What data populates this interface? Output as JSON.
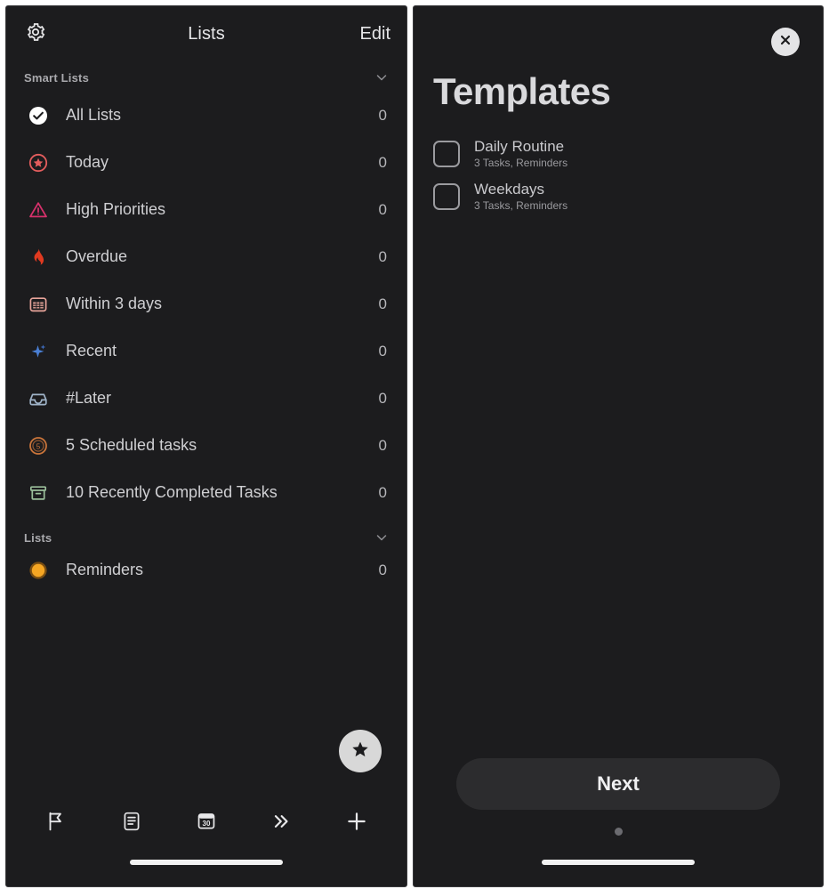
{
  "left_panel": {
    "header": {
      "settings_icon": "gear-icon",
      "title": "Lists",
      "edit_label": "Edit"
    },
    "sections": [
      {
        "label": "Smart Lists",
        "collapse_icon": "chevron-down-icon",
        "items": [
          {
            "icon": "check-circle-icon",
            "label": "All Lists",
            "count": "0",
            "color": "#ffffff"
          },
          {
            "icon": "star-circle-icon",
            "label": "Today",
            "count": "0",
            "color": "#e35d5d"
          },
          {
            "icon": "warning-triangle-icon",
            "label": "High Priorities",
            "count": "0",
            "color": "#d6306b"
          },
          {
            "icon": "flame-icon",
            "label": "Overdue",
            "count": "0",
            "color": "#e03a20"
          },
          {
            "icon": "calendar-icon",
            "label": "Within 3 days",
            "count": "0",
            "color": "#e8a49a"
          },
          {
            "icon": "sparkle-icon",
            "label": "Recent",
            "count": "0",
            "color": "#4a7fd4"
          },
          {
            "icon": "inbox-icon",
            "label": "#Later",
            "count": "0",
            "color": "#9fb3c8"
          },
          {
            "icon": "clock-five-icon",
            "label": "5 Scheduled tasks",
            "count": "0",
            "color": "#c9743a"
          },
          {
            "icon": "archive-box-icon",
            "label": "10 Recently Completed Tasks",
            "count": "0",
            "color": "#9bbf9b"
          }
        ]
      },
      {
        "label": "Lists",
        "collapse_icon": "chevron-down-icon",
        "items": [
          {
            "icon": "filled-circle-icon",
            "label": "Reminders",
            "count": "0",
            "color": "#f5a623"
          }
        ]
      }
    ],
    "fab": {
      "icon": "star-icon"
    },
    "tabbar": [
      {
        "icon": "flag-icon",
        "name": "tab-flag"
      },
      {
        "icon": "list-note-icon",
        "name": "tab-notes"
      },
      {
        "icon": "calendar-30-icon",
        "name": "tab-calendar",
        "badge": "30"
      },
      {
        "icon": "double-chevron-right-icon",
        "name": "tab-forward"
      },
      {
        "icon": "plus-icon",
        "name": "tab-add"
      }
    ]
  },
  "right_panel": {
    "close_icon": "close-icon",
    "title": "Templates",
    "templates": [
      {
        "name": "Daily Routine",
        "subtitle": "3 Tasks, Reminders",
        "checked": false
      },
      {
        "name": "Weekdays",
        "subtitle": "3 Tasks, Reminders",
        "checked": false
      }
    ],
    "next_label": "Next",
    "pager": {
      "dots": 1,
      "active_index": 0
    }
  },
  "colors": {
    "panel_bg": "#1c1c1e",
    "page_bg": "#ffffff",
    "text_primary": "#cfcfd2",
    "text_secondary": "#9a9a9e",
    "accent_orange": "#f5a623"
  }
}
